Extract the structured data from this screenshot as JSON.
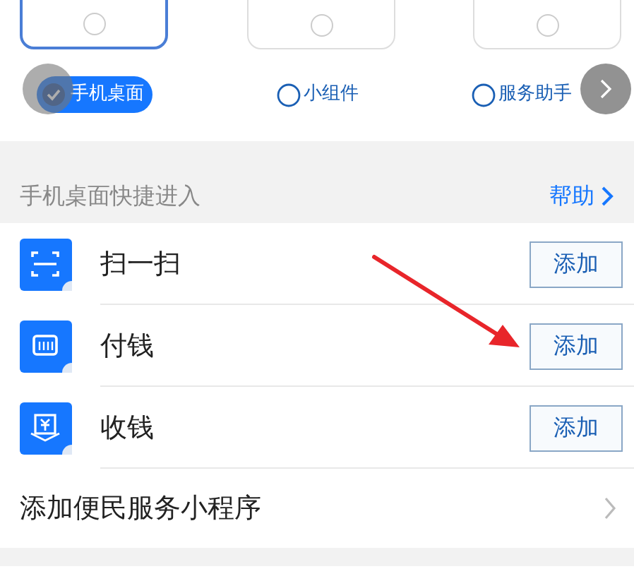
{
  "layouts": [
    {
      "label": "手机桌面",
      "selected": true
    },
    {
      "label": "小组件",
      "selected": false
    },
    {
      "label": "服务助手",
      "selected": false
    }
  ],
  "section": {
    "title": "手机桌面快捷进入",
    "help": "帮助"
  },
  "shortcuts": [
    {
      "kind": "scan",
      "name": "扫一扫",
      "button": "添加"
    },
    {
      "kind": "pay",
      "name": "付钱",
      "button": "添加"
    },
    {
      "kind": "receive",
      "name": "收钱",
      "button": "添加"
    }
  ],
  "more": {
    "label": "添加便民服务小程序"
  }
}
